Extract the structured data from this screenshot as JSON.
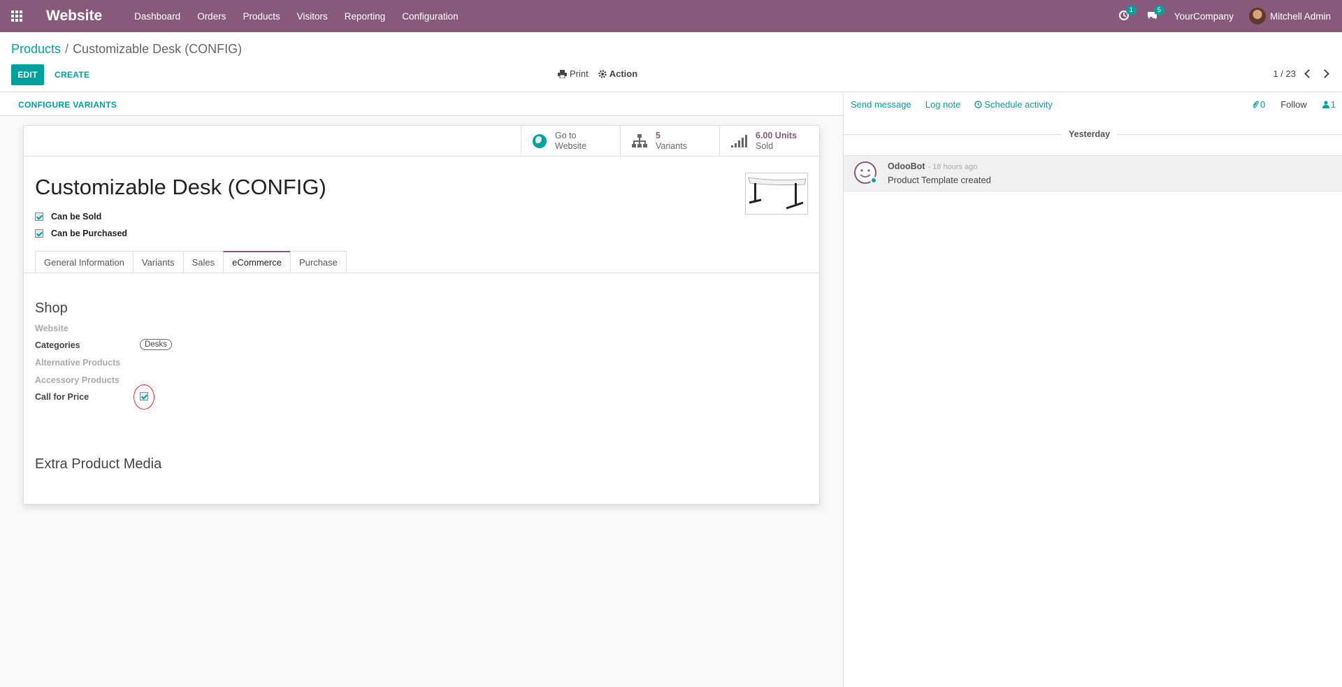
{
  "navbar": {
    "app_name": "Website",
    "menu": [
      "Dashboard",
      "Orders",
      "Products",
      "Visitors",
      "Reporting",
      "Configuration"
    ],
    "activity_count": "1",
    "message_count": "5",
    "company": "YourCompany",
    "user": "Mitchell Admin",
    "bg_color": "#875a7b"
  },
  "control": {
    "breadcrumb_root": "Products",
    "breadcrumb_sep": "/",
    "breadcrumb_current": "Customizable Desk (CONFIG)",
    "edit_label": "EDIT",
    "create_label": "CREATE",
    "print_label": "Print",
    "action_label": "Action",
    "pager": "1 / 23"
  },
  "statusbar": {
    "configure_label": "CONFIGURE VARIANTS"
  },
  "smart_buttons": {
    "website": {
      "line1": "Go to",
      "line2": "Website"
    },
    "variants": {
      "value": "5",
      "label": "Variants"
    },
    "sold": {
      "value": "6.00 Units",
      "label": "Sold"
    }
  },
  "form": {
    "title": "Customizable Desk (CONFIG)",
    "can_be_sold": "Can be Sold",
    "can_be_purchased": "Can be Purchased",
    "tabs": [
      "General Information",
      "Variants",
      "Sales",
      "eCommerce",
      "Purchase"
    ],
    "active_tab": "eCommerce",
    "shop_title": "Shop",
    "fields": {
      "website": "Website",
      "categories": "Categories",
      "category_tag": "Desks",
      "alternative": "Alternative Products",
      "accessory": "Accessory Products",
      "call_for_price": "Call for Price"
    },
    "media_title": "Extra Product Media"
  },
  "chatter": {
    "send_message": "Send message",
    "log_note": "Log note",
    "schedule_activity": "Schedule activity",
    "attachments": "0",
    "follow": "Follow",
    "followers": "1",
    "day": "Yesterday",
    "author": "OdooBot",
    "time": "- 18 hours ago",
    "body": "Product Template created"
  },
  "colors": {
    "accent": "#00a09d",
    "brand": "#875a7b",
    "highlight": "#e0202a"
  }
}
